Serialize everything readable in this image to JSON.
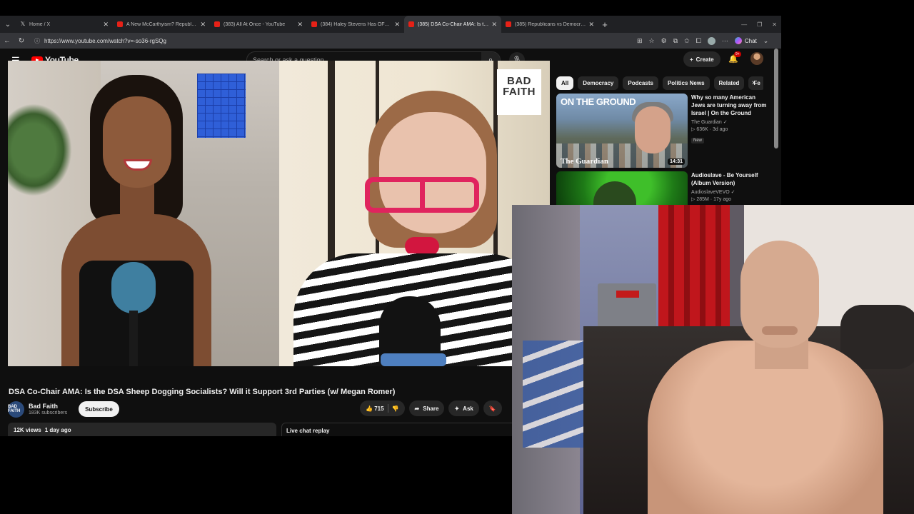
{
  "browser": {
    "tabs": [
      {
        "title": "Home / X",
        "icon": "x-logo-icon",
        "active": false
      },
      {
        "title": "A New McCarthyism? Republicans",
        "icon": "youtube-icon",
        "active": false
      },
      {
        "title": "(383) All At Once - YouTube",
        "icon": "youtube-icon",
        "active": false
      },
      {
        "title": "(384) Haley Stevens Has OFFICIAL",
        "icon": "youtube-icon",
        "active": false
      },
      {
        "title": "(385) DSA Co-Chair AMA: Is the D",
        "icon": "youtube-icon",
        "active": true
      },
      {
        "title": "(385) Republicans vs Democrats",
        "icon": "youtube-icon",
        "active": false
      }
    ],
    "url": "https://www.youtube.com/watch?v=-so36-rgSQg",
    "chat_label": "Chat"
  },
  "youtube": {
    "logo_text": "YouTube",
    "search_placeholder": "Search or ask a question",
    "create_label": "Create",
    "notification_count": "9+"
  },
  "video": {
    "overlay_logo": "BAD FAITH",
    "title": "DSA Co-Chair AMA: Is the DSA Sheep Dogging Socialists? Will it Support 3rd Parties (w/ Megan Romer)",
    "channel": {
      "name": "Bad Faith",
      "subscribers": "183K subscribers",
      "avatar_text": "BAD FAITH",
      "subscribe_label": "Subscribe"
    },
    "likes": "715",
    "share_label": "Share",
    "ask_label": "Ask",
    "views": "12K views",
    "age": "1 day ago",
    "live_chat_label": "Live chat replay"
  },
  "sidebar": {
    "chips": [
      "All",
      "Democracy",
      "Podcasts",
      "Politics News",
      "Related",
      "Fe"
    ],
    "recommendations": [
      {
        "title": "Why so many American Jews are turning away from Israel | On the Ground",
        "channel": "The Guardian",
        "views": "636K",
        "age": "3d ago",
        "badge": "New",
        "duration": "14:31",
        "thumb_text_1": "ON THE GROUND",
        "thumb_text_2": "The Guardian"
      },
      {
        "title": "Audioslave - Be Yourself (Album Version)",
        "channel": "AudioslaveVEVO",
        "views": "285M",
        "age": "17y ago"
      }
    ]
  },
  "colors": {
    "yt_red": "#ff0000",
    "background": "#0f0f0f",
    "accent_glasses": "#e0245e"
  }
}
